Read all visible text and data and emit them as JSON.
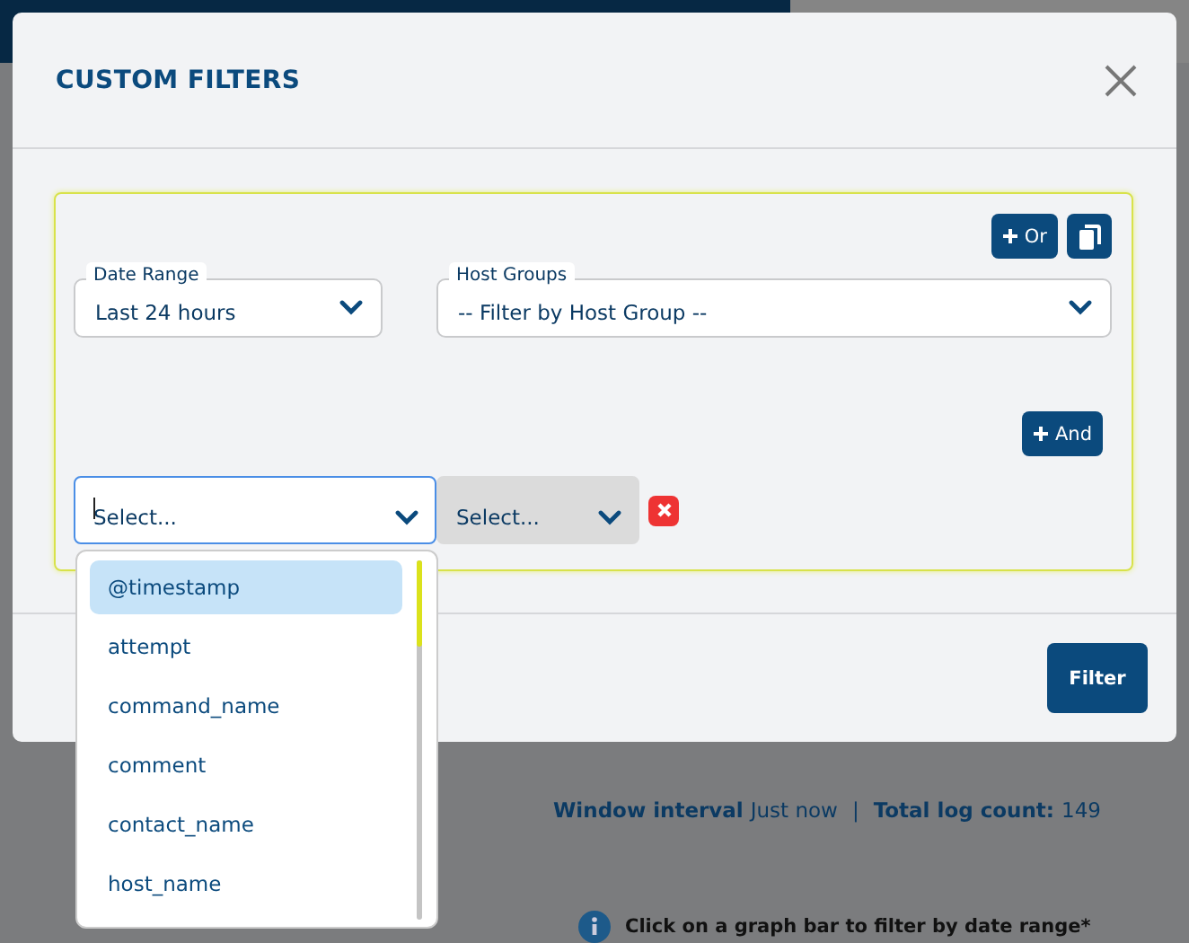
{
  "background": {
    "summary": {
      "interval_label": "Window interval",
      "interval_value": "Just now",
      "separator": "|",
      "count_label": "Total log count:",
      "count_value": "149"
    },
    "hint": "Click on a graph bar to filter by date range*"
  },
  "modal": {
    "title": "CUSTOM FILTERS",
    "group": {
      "or_button": "Or",
      "date_range": {
        "label": "Date Range",
        "value": "Last 24 hours"
      },
      "host_groups": {
        "label": "Host Groups",
        "value": "-- Filter by Host Group --"
      },
      "and_button": "And",
      "condition": {
        "field": {
          "placeholder": "Select...",
          "focused": true
        },
        "operator": {
          "placeholder": "Select...",
          "disabled": true
        }
      },
      "options": [
        {
          "label": "@timestamp",
          "selected": true
        },
        {
          "label": "attempt",
          "selected": false
        },
        {
          "label": "command_name",
          "selected": false
        },
        {
          "label": "comment",
          "selected": false
        },
        {
          "label": "contact_name",
          "selected": false
        },
        {
          "label": "host_name",
          "selected": false
        }
      ]
    },
    "filter_button": "Filter"
  }
}
